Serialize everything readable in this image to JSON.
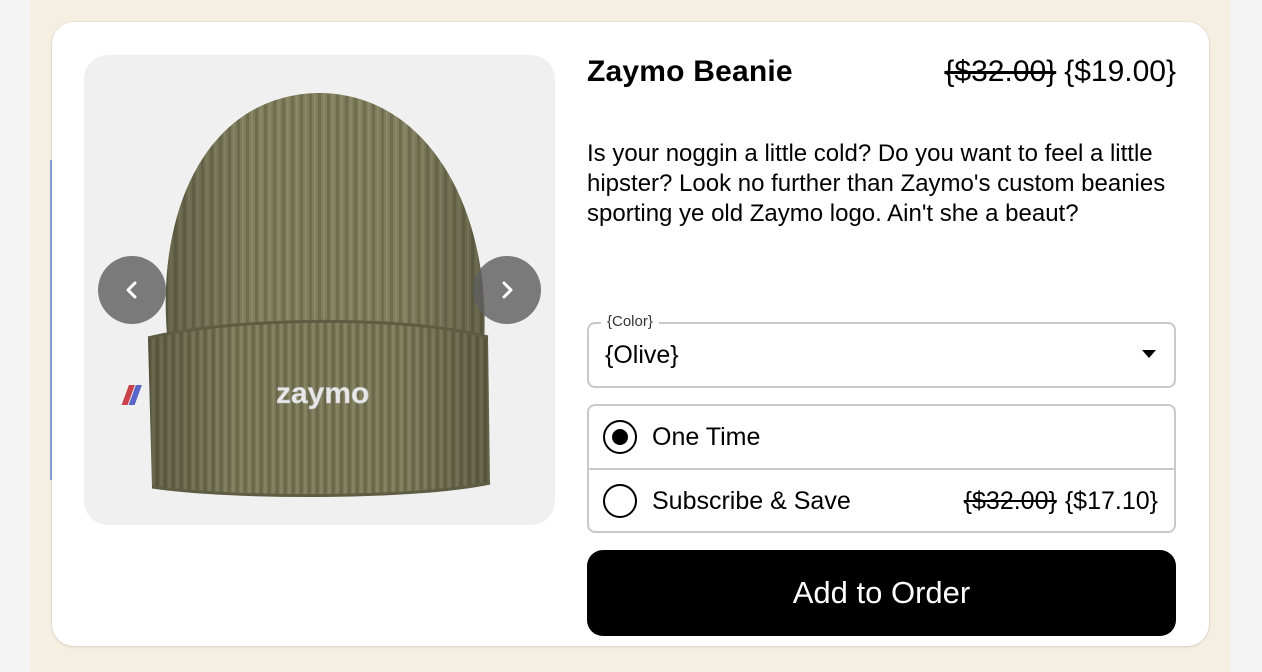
{
  "product": {
    "title": "Zaymo Beanie",
    "price_original": "{$32.00}",
    "price_sale": "{$19.00}",
    "description": "Is your noggin a little cold? Do you want to feel a little hipster? Look no further than Zaymo's custom beanies sporting ye old Zaymo logo. Ain't she a beaut?",
    "image_logo_text": "zaymo"
  },
  "color_select": {
    "legend": "{Color}",
    "value": "{Olive}"
  },
  "purchase_options": [
    {
      "label": "One Time",
      "selected": true
    },
    {
      "label": "Subscribe & Save",
      "selected": false,
      "price_original": "{$32.00}",
      "price_sale": "{$17.10}"
    }
  ],
  "cta": {
    "label": "Add to Order"
  },
  "icons": {
    "prev": "chevron-left-icon",
    "next": "chevron-right-icon",
    "dropdown": "caret-down-icon"
  },
  "colors": {
    "beanie": "#7f7d5c",
    "image_bg": "#f0f0f0",
    "page_bg": "#f5efe2",
    "cta_bg": "#000000"
  }
}
